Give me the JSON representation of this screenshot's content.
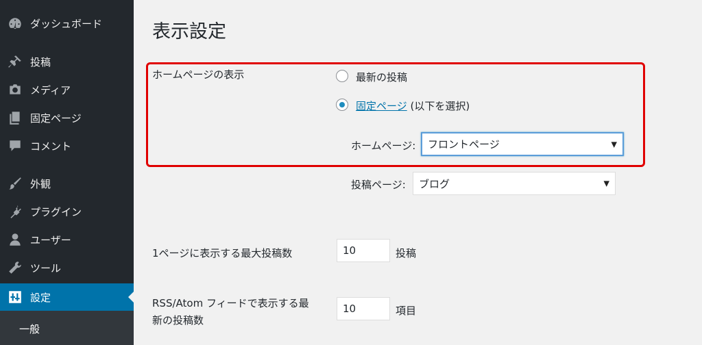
{
  "sidebar": {
    "items": [
      {
        "label": "ダッシュボード",
        "icon": "dashboard-icon"
      },
      {
        "label": "投稿",
        "icon": "pin-icon"
      },
      {
        "label": "メディア",
        "icon": "media-icon"
      },
      {
        "label": "固定ページ",
        "icon": "pages-icon"
      },
      {
        "label": "コメント",
        "icon": "comment-icon"
      },
      {
        "label": "外観",
        "icon": "brush-icon"
      },
      {
        "label": "プラグイン",
        "icon": "plugin-icon"
      },
      {
        "label": "ユーザー",
        "icon": "user-icon"
      },
      {
        "label": "ツール",
        "icon": "wrench-icon"
      },
      {
        "label": "設定",
        "icon": "settings-icon",
        "current": true
      }
    ],
    "submenu": [
      "一般"
    ]
  },
  "main": {
    "title": "表示設定",
    "homepage_display": {
      "label": "ホームページの表示",
      "option_latest": "最新の投稿",
      "option_static_link": "固定ページ",
      "option_static_suffix": "(以下を選択)",
      "selected": "static",
      "homepage_label": "ホームページ:",
      "homepage_value": "フロントページ",
      "posts_page_label": "投稿ページ:",
      "posts_page_value": "ブログ"
    },
    "posts_per_page": {
      "label": "1ページに表示する最大投稿数",
      "value": "10",
      "unit": "投稿"
    },
    "feed_items": {
      "label_line1": "RSS/Atom フィードで表示する最",
      "label_line2": "新の投稿数",
      "value": "10",
      "unit": "項目"
    }
  },
  "colors": {
    "sidebar_bg": "#23282d",
    "accent": "#0073aa",
    "highlight": "#e00000"
  }
}
